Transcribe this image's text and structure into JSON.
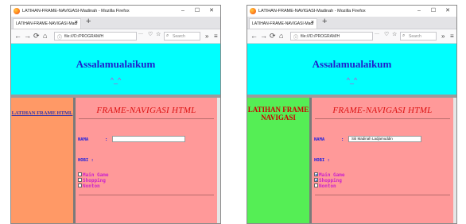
{
  "windows": [
    {
      "window_title": "LATIHAN-FRAME-NAVIGASI-Madinah - Mozilla Firefox",
      "tab_label": "LATIHAN-FRAME-NAVIGASI-Madi",
      "url": "file:///D:/PROGRAM/H",
      "search_placeholder": "Search",
      "header": {
        "title": "Assalamualaikum",
        "emoticon": "^_^"
      },
      "left_frame": {
        "link_text": "LATIHAN FRAME HTML",
        "background": "#ff9966"
      },
      "right_frame": {
        "title": "FRAME-NAVIGASI HTML",
        "name_label": "NAMA",
        "colon": ":",
        "name_value": "",
        "hobby_label": "HOBI :",
        "options": [
          {
            "label": "Main Game",
            "checked": false
          },
          {
            "label": "Shopping",
            "checked": false
          },
          {
            "label": "Nonton",
            "checked": false
          }
        ]
      }
    },
    {
      "window_title": "LATIHAN-FRAME-NAVIGASI-Madinah - Mozilla Firefox",
      "tab_label": "LATIHAN-FRAME-NAVIGASI-Madi",
      "url": "file:///D:/PROGRAM/H",
      "search_placeholder": "Search",
      "header": {
        "title": "Assalamualaikum",
        "emoticon": "^_^"
      },
      "left_frame": {
        "link_text": "LATIHAN FRAME NAVIGASI",
        "background": "#55ee55"
      },
      "right_frame": {
        "title": "FRAME-NAVIGASI HTML",
        "name_label": "NAMA",
        "colon": ":",
        "name_value": "Siti Madinah Ladjamuddin",
        "hobby_label": "HOBI :",
        "options": [
          {
            "label": "Main Game",
            "checked": true
          },
          {
            "label": "Shopping",
            "checked": true
          },
          {
            "label": "Nonton",
            "checked": false
          }
        ]
      }
    }
  ],
  "colors": {
    "header_bg": "#00ffff",
    "form_bg": "#ff9999",
    "title_red": "#dd1111",
    "label_blue": "#2222dd",
    "option_magenta": "#cc22cc"
  },
  "icons": {
    "browser": "firefox-icon",
    "back": "back-arrow-icon",
    "forward": "forward-arrow-icon",
    "reload": "reload-icon",
    "home": "home-icon",
    "info": "info-icon",
    "search": "search-icon",
    "menu": "hamburger-menu-icon"
  }
}
